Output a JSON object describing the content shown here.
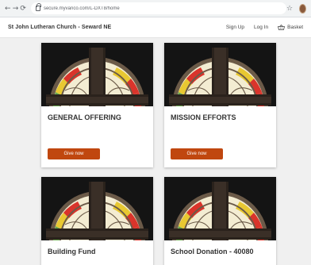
{
  "browser": {
    "back_icon": "back-arrow-icon",
    "forward_icon": "forward-arrow-icon",
    "reload_icon": "reload-icon",
    "url": "secure.myvanco.com/L-DXT8/home",
    "bookmark_icon": "star-icon"
  },
  "header": {
    "site_title": "St John Lutheran Church - Seward NE",
    "sign_up": "Sign Up",
    "log_in": "Log In",
    "basket": "Basket"
  },
  "funds": [
    {
      "title": "GENERAL OFFERING",
      "button": "Give now"
    },
    {
      "title": "MISSION EFFORTS",
      "button": "Give now"
    },
    {
      "title": "Building Fund"
    },
    {
      "title": "School Donation - 40080"
    }
  ],
  "colors": {
    "accent_button": "#c0470f",
    "page_background": "#f0f0f0",
    "window_red": "#d9342b",
    "window_yellow": "#e8c832",
    "window_green": "#6aa84f",
    "window_cream": "#f3ecd2",
    "window_frame": "#6b5a48"
  }
}
